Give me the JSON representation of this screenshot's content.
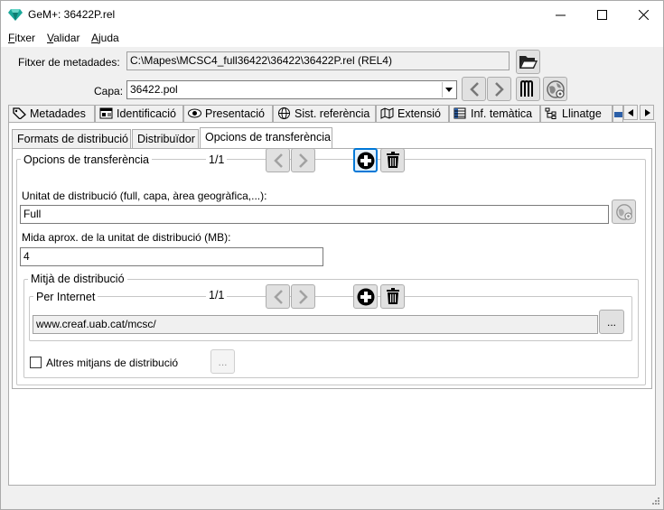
{
  "window": {
    "title": "GeM+: 36422P.rel"
  },
  "menu": [
    {
      "label": "Fitxer",
      "accel": "F",
      "rest": "itxer"
    },
    {
      "label": "Validar",
      "accel": "V",
      "rest": "alidar"
    },
    {
      "label": "Ajuda",
      "accel": "A",
      "rest": "juda"
    }
  ],
  "metadata_file": {
    "label": "Fitxer de metadades:",
    "value": "C:\\Mapes\\MCSC4_full36422\\36422\\36422P.rel (REL4)"
  },
  "layer": {
    "label": "Capa:",
    "value": "36422.pol"
  },
  "tabs": [
    {
      "label": "Metadades",
      "icon": "tag-icon"
    },
    {
      "label": "Identificació",
      "icon": "id-card-icon"
    },
    {
      "label": "Presentació",
      "icon": "eye-icon"
    },
    {
      "label": "Sist. referència",
      "icon": "globe-icon"
    },
    {
      "label": "Extensió",
      "icon": "map-extent-icon"
    },
    {
      "label": "Inf. temàtica",
      "icon": "table-icon"
    },
    {
      "label": "Llinatge",
      "icon": "tree-icon"
    }
  ],
  "subtabs": [
    {
      "label": "Formats de distribució"
    },
    {
      "label": "Distribuïdor"
    },
    {
      "label": "Opcions de transferència"
    }
  ],
  "transfer_options": {
    "title": "Opcions de transferència",
    "counter": "1/1",
    "unit_label": "Unitat de distribució (full, capa, àrea geogràfica,...):",
    "unit_value": "Full",
    "size_label": "Mida aprox. de la unitat de distribució (MB):",
    "size_value": "4"
  },
  "medium": {
    "title": "Mitjà de distribució",
    "internet": {
      "title": "Per Internet",
      "counter": "1/1",
      "url": "www.creaf.uab.cat/mcsc/",
      "browse_label": "..."
    },
    "other": {
      "label": "Altres mitjans de distribució",
      "checked": false,
      "button_label": "..."
    }
  },
  "colors": {
    "accent": "#0078d7",
    "titlebar_bg": "#ffffff",
    "window_bg": "#f0f0f0"
  }
}
